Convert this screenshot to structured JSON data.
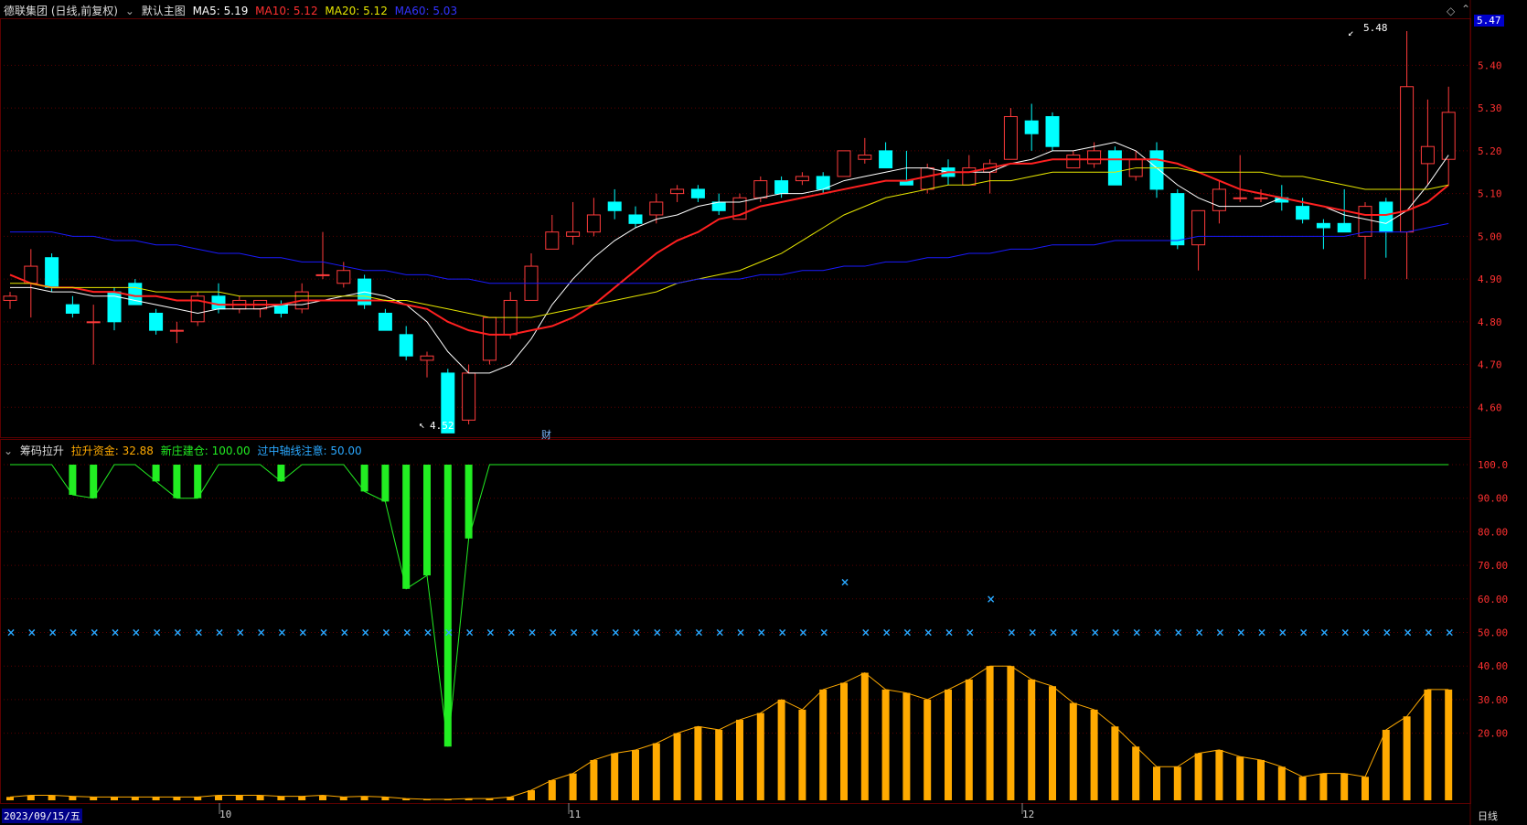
{
  "header": {
    "stock_name": "德联集团 (日线,前复权)",
    "main_chart_label": "默认主图",
    "ma5": "MA5: 5.19",
    "ma10": "MA10: 5.12",
    "ma20": "MA20: 5.12",
    "ma60": "MA60: 5.03"
  },
  "indicator": {
    "name": "筹码拉升",
    "field1": "拉升资金: 32.88",
    "field2": "新庄建仓: 100.00",
    "field3": "过中轴线注意: 50.00"
  },
  "price_axis": {
    "labels": [
      "5.40",
      "5.30",
      "5.20",
      "5.10",
      "5.00",
      "4.90",
      "4.80",
      "4.70",
      "4.60"
    ],
    "current": "5.47"
  },
  "ind_axis": {
    "labels": [
      "100.0",
      "90.00",
      "80.00",
      "70.00",
      "60.00",
      "50.00",
      "40.00",
      "30.00",
      "20.00"
    ]
  },
  "x_axis": {
    "start_date": "2023/09/15/五",
    "months": [
      "10",
      "11",
      "12"
    ],
    "period": "日线"
  },
  "annotations": {
    "high": "5.48",
    "low": "4.52",
    "event": "财"
  },
  "colors": {
    "up": "#ff3b3b",
    "down": "#00ffff",
    "ma5": "#ffffff",
    "ma10": "#ff2020",
    "ma20": "#e6e600",
    "ma60": "#1a1aff",
    "grid": "#5a0000",
    "bars_green": "#22ee22",
    "bars_orange": "#ffaa00",
    "cross": "#2aa8ff"
  },
  "chart_data": {
    "type": "candlestick",
    "ohlc": [
      [
        4.85,
        4.87,
        4.83,
        4.86
      ],
      [
        4.89,
        4.97,
        4.81,
        4.93
      ],
      [
        4.95,
        4.96,
        4.87,
        4.88
      ],
      [
        4.84,
        4.86,
        4.81,
        4.82
      ],
      [
        4.8,
        4.84,
        4.7,
        4.8
      ],
      [
        4.87,
        4.88,
        4.78,
        4.8
      ],
      [
        4.89,
        4.9,
        4.84,
        4.84
      ],
      [
        4.82,
        4.83,
        4.77,
        4.78
      ],
      [
        4.78,
        4.8,
        4.75,
        4.78
      ],
      [
        4.8,
        4.87,
        4.79,
        4.86
      ],
      [
        4.86,
        4.89,
        4.82,
        4.83
      ],
      [
        4.83,
        4.86,
        4.82,
        4.85
      ],
      [
        4.83,
        4.85,
        4.81,
        4.85
      ],
      [
        4.84,
        4.85,
        4.81,
        4.82
      ],
      [
        4.83,
        4.89,
        4.82,
        4.87
      ],
      [
        4.91,
        5.01,
        4.9,
        4.91
      ],
      [
        4.89,
        4.94,
        4.88,
        4.92
      ],
      [
        4.9,
        4.91,
        4.83,
        4.84
      ],
      [
        4.82,
        4.83,
        4.78,
        4.78
      ],
      [
        4.77,
        4.79,
        4.71,
        4.72
      ],
      [
        4.71,
        4.73,
        4.67,
        4.72
      ],
      [
        4.68,
        4.69,
        4.54,
        4.54
      ],
      [
        4.57,
        4.7,
        4.56,
        4.68
      ],
      [
        4.71,
        4.81,
        4.7,
        4.81
      ],
      [
        4.77,
        4.87,
        4.76,
        4.85
      ],
      [
        4.85,
        4.96,
        4.85,
        4.93
      ],
      [
        4.97,
        5.05,
        4.97,
        5.01
      ],
      [
        5.0,
        5.08,
        4.98,
        5.01
      ],
      [
        5.01,
        5.09,
        5.0,
        5.05
      ],
      [
        5.08,
        5.11,
        5.04,
        5.06
      ],
      [
        5.05,
        5.07,
        5.02,
        5.03
      ],
      [
        5.05,
        5.1,
        5.03,
        5.08
      ],
      [
        5.1,
        5.12,
        5.08,
        5.11
      ],
      [
        5.11,
        5.12,
        5.08,
        5.09
      ],
      [
        5.08,
        5.1,
        5.05,
        5.06
      ],
      [
        5.04,
        5.1,
        5.04,
        5.09
      ],
      [
        5.09,
        5.14,
        5.08,
        5.13
      ],
      [
        5.13,
        5.14,
        5.09,
        5.1
      ],
      [
        5.13,
        5.15,
        5.12,
        5.14
      ],
      [
        5.14,
        5.15,
        5.1,
        5.11
      ],
      [
        5.14,
        5.2,
        5.14,
        5.2
      ],
      [
        5.18,
        5.23,
        5.17,
        5.19
      ],
      [
        5.2,
        5.22,
        5.16,
        5.16
      ],
      [
        5.13,
        5.2,
        5.12,
        5.12
      ],
      [
        5.11,
        5.17,
        5.1,
        5.16
      ],
      [
        5.16,
        5.18,
        5.12,
        5.14
      ],
      [
        5.12,
        5.19,
        5.12,
        5.16
      ],
      [
        5.15,
        5.18,
        5.1,
        5.17
      ],
      [
        5.18,
        5.3,
        5.18,
        5.28
      ],
      [
        5.27,
        5.31,
        5.2,
        5.24
      ],
      [
        5.28,
        5.29,
        5.2,
        5.21
      ],
      [
        5.16,
        5.2,
        5.16,
        5.19
      ],
      [
        5.17,
        5.22,
        5.16,
        5.2
      ],
      [
        5.2,
        5.21,
        5.12,
        5.12
      ],
      [
        5.14,
        5.2,
        5.13,
        5.18
      ],
      [
        5.2,
        5.22,
        5.09,
        5.11
      ],
      [
        5.1,
        5.11,
        4.97,
        4.98
      ],
      [
        4.98,
        5.04,
        4.92,
        5.06
      ],
      [
        5.06,
        5.13,
        5.03,
        5.11
      ],
      [
        5.09,
        5.19,
        5.08,
        5.09
      ],
      [
        5.09,
        5.11,
        5.08,
        5.09
      ],
      [
        5.09,
        5.12,
        5.06,
        5.08
      ],
      [
        5.07,
        5.09,
        5.03,
        5.04
      ],
      [
        5.03,
        5.04,
        4.97,
        5.02
      ],
      [
        5.03,
        5.11,
        5.01,
        5.01
      ],
      [
        5.0,
        5.08,
        4.9,
        5.07
      ],
      [
        5.08,
        5.09,
        4.95,
        5.01
      ],
      [
        5.01,
        5.48,
        4.9,
        5.35
      ],
      [
        5.17,
        5.32,
        5.12,
        5.21
      ],
      [
        5.18,
        5.35,
        5.12,
        5.29
      ]
    ],
    "ma5": [
      4.88,
      4.88,
      4.87,
      4.87,
      4.86,
      4.86,
      4.85,
      4.84,
      4.83,
      4.82,
      4.83,
      4.83,
      4.83,
      4.84,
      4.84,
      4.85,
      4.86,
      4.87,
      4.86,
      4.84,
      4.8,
      4.73,
      4.68,
      4.68,
      4.7,
      4.76,
      4.84,
      4.9,
      4.95,
      4.99,
      5.02,
      5.04,
      5.05,
      5.07,
      5.08,
      5.08,
      5.09,
      5.1,
      5.1,
      5.11,
      5.13,
      5.14,
      5.15,
      5.16,
      5.16,
      5.15,
      5.15,
      5.15,
      5.17,
      5.18,
      5.2,
      5.2,
      5.21,
      5.22,
      5.2,
      5.16,
      5.12,
      5.09,
      5.07,
      5.07,
      5.07,
      5.09,
      5.08,
      5.07,
      5.05,
      5.04,
      5.03,
      5.06,
      5.12,
      5.19
    ],
    "ma10": [
      4.91,
      4.89,
      4.88,
      4.88,
      4.87,
      4.87,
      4.86,
      4.86,
      4.85,
      4.85,
      4.84,
      4.84,
      4.84,
      4.84,
      4.85,
      4.85,
      4.85,
      4.85,
      4.85,
      4.84,
      4.83,
      4.8,
      4.78,
      4.77,
      4.77,
      4.78,
      4.79,
      4.81,
      4.84,
      4.88,
      4.92,
      4.96,
      4.99,
      5.01,
      5.04,
      5.05,
      5.07,
      5.08,
      5.09,
      5.1,
      5.11,
      5.12,
      5.13,
      5.13,
      5.14,
      5.15,
      5.15,
      5.16,
      5.17,
      5.17,
      5.18,
      5.18,
      5.18,
      5.18,
      5.18,
      5.18,
      5.17,
      5.15,
      5.13,
      5.11,
      5.1,
      5.09,
      5.08,
      5.07,
      5.06,
      5.05,
      5.05,
      5.06,
      5.08,
      5.12
    ],
    "ma20": [
      4.89,
      4.89,
      4.88,
      4.88,
      4.88,
      4.88,
      4.88,
      4.87,
      4.87,
      4.87,
      4.87,
      4.86,
      4.86,
      4.86,
      4.86,
      4.86,
      4.86,
      4.86,
      4.85,
      4.85,
      4.84,
      4.83,
      4.82,
      4.81,
      4.81,
      4.81,
      4.82,
      4.83,
      4.84,
      4.85,
      4.86,
      4.87,
      4.89,
      4.9,
      4.91,
      4.92,
      4.94,
      4.96,
      4.99,
      5.02,
      5.05,
      5.07,
      5.09,
      5.1,
      5.11,
      5.12,
      5.12,
      5.13,
      5.13,
      5.14,
      5.15,
      5.15,
      5.15,
      5.15,
      5.16,
      5.16,
      5.16,
      5.15,
      5.15,
      5.15,
      5.15,
      5.14,
      5.14,
      5.13,
      5.12,
      5.11,
      5.11,
      5.11,
      5.11,
      5.12
    ],
    "ma60": [
      5.01,
      5.01,
      5.01,
      5.0,
      5.0,
      4.99,
      4.99,
      4.98,
      4.98,
      4.97,
      4.96,
      4.96,
      4.95,
      4.95,
      4.94,
      4.94,
      4.93,
      4.92,
      4.92,
      4.91,
      4.91,
      4.9,
      4.9,
      4.89,
      4.89,
      4.89,
      4.89,
      4.89,
      4.89,
      4.89,
      4.89,
      4.89,
      4.89,
      4.9,
      4.9,
      4.9,
      4.91,
      4.91,
      4.92,
      4.92,
      4.93,
      4.93,
      4.94,
      4.94,
      4.95,
      4.95,
      4.96,
      4.96,
      4.97,
      4.97,
      4.98,
      4.98,
      4.98,
      4.99,
      4.99,
      4.99,
      4.99,
      5.0,
      5.0,
      5.0,
      5.0,
      5.0,
      5.0,
      5.0,
      5.0,
      5.01,
      5.01,
      5.01,
      5.02,
      5.03
    ],
    "indicator_green": [
      100,
      100,
      100,
      91,
      90,
      100,
      100,
      95,
      90,
      90,
      100,
      100,
      100,
      95,
      100,
      100,
      100,
      92,
      89,
      63,
      67,
      16,
      78,
      100,
      100,
      100,
      100,
      100,
      100,
      100,
      100,
      100,
      100,
      100,
      100,
      100,
      100,
      100,
      100,
      100,
      100,
      100,
      100,
      100,
      100,
      100,
      100,
      100,
      100,
      100,
      100,
      100,
      100,
      100,
      100,
      100,
      100,
      100,
      100,
      100,
      100,
      100,
      100,
      100,
      100,
      100,
      100,
      100,
      100,
      100
    ],
    "indicator_cross": [
      50,
      50,
      50,
      50,
      50,
      50,
      50,
      50,
      50,
      50,
      50,
      50,
      50,
      50,
      50,
      50,
      50,
      50,
      50,
      50,
      50,
      50,
      50,
      50,
      50,
      50,
      50,
      50,
      50,
      50,
      50,
      50,
      50,
      50,
      50,
      50,
      50,
      50,
      50,
      50,
      65,
      50,
      50,
      50,
      50,
      50,
      50,
      60,
      50,
      50,
      50,
      50,
      50,
      50,
      50,
      50,
      50,
      50,
      50,
      50,
      50,
      50,
      50,
      50,
      50,
      50,
      50,
      50,
      50,
      50
    ],
    "indicator_orange": [
      1,
      1.5,
      1.5,
      1.2,
      1,
      1,
      1,
      1,
      1,
      1,
      1.5,
      1.5,
      1.5,
      1.2,
      1.2,
      1.5,
      1,
      1.2,
      1,
      0.5,
      0.3,
      0.3,
      0.5,
      0.5,
      1,
      3,
      6,
      8,
      12,
      14,
      15,
      17,
      20,
      22,
      21,
      24,
      26,
      30,
      27,
      33,
      35,
      38,
      33,
      32,
      30,
      33,
      36,
      40,
      40,
      36,
      34,
      29,
      27,
      22,
      16,
      10,
      10,
      14,
      15,
      13,
      12,
      10,
      7,
      8,
      8,
      7,
      21,
      25,
      33,
      33
    ]
  }
}
